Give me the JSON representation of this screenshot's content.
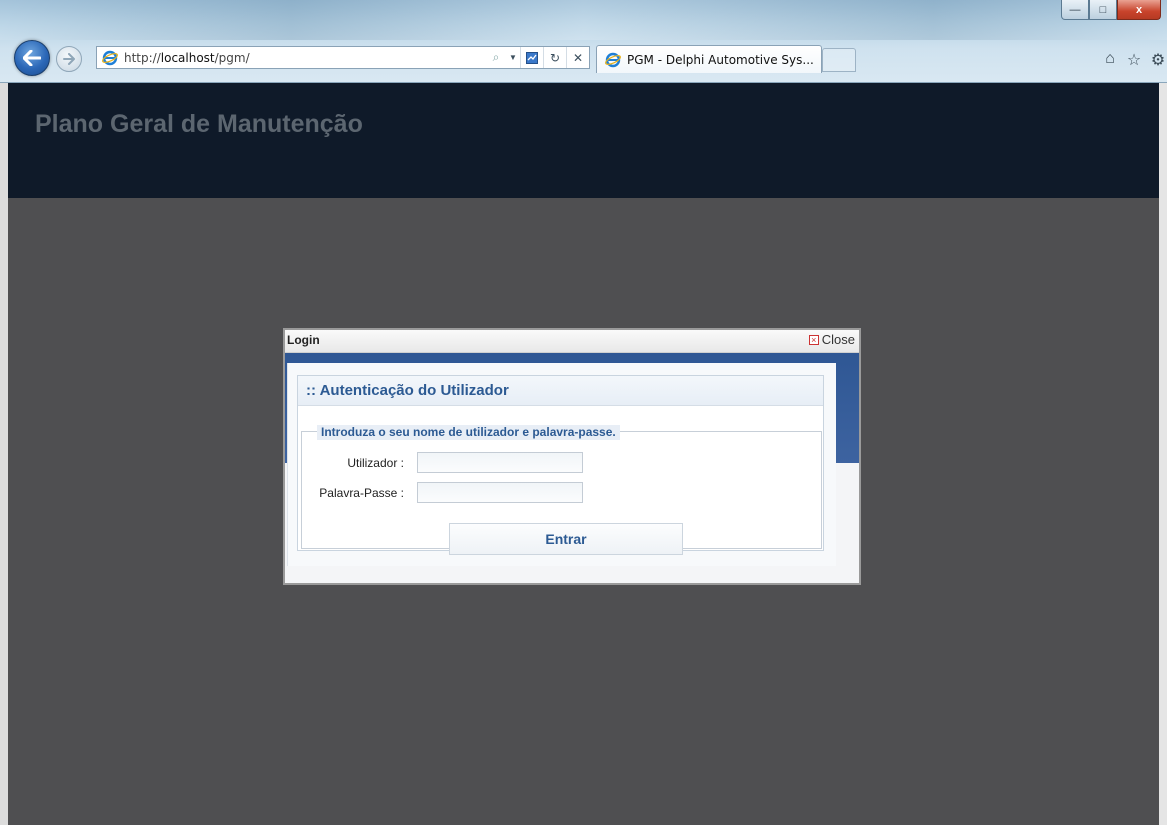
{
  "browser": {
    "address": {
      "prefix": "http://",
      "host": "localhost",
      "path": "/pgm/"
    },
    "tab_title": "PGM - Delphi Automotive Sys...",
    "window_controls": {
      "minimize": "—",
      "maximize": "□",
      "close": "x"
    },
    "icons": {
      "back": "back-arrow-icon",
      "forward": "forward-arrow-icon",
      "search": "search-icon",
      "compat": "compatibility-view-icon",
      "refresh": "refresh-icon",
      "stop": "stop-icon",
      "home": "home-icon",
      "favorites": "star-icon",
      "tools": "gear-icon"
    }
  },
  "page": {
    "title": "Plano Geral de Manutenção"
  },
  "dialog": {
    "title": "Login",
    "close_label": "Close",
    "section_title": ":: Autenticação do Utilizador",
    "legend": "Introduza o seu nome de utilizador e palavra-passe.",
    "username_label": "Utilizador :",
    "username_value": "",
    "password_label": "Palavra-Passe :",
    "password_value": "",
    "submit_label": "Entrar"
  },
  "colors": {
    "header_bg": "#0f1a29",
    "page_bg": "#4f4f51",
    "accent_blue": "#2c5a93",
    "dialog_band": "#3d63a0"
  }
}
